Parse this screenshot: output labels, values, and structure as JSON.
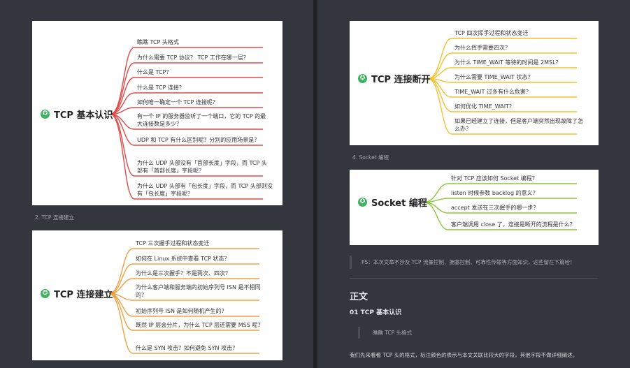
{
  "cards": {
    "basic": {
      "title": "TCP 基本认识",
      "color": "#e04a4a",
      "items": [
        "瞧瞧 TCP 头格式",
        "为什么需要 TCP 协议？ TCP 工作在哪一层？",
        "什么是 TCP？",
        "什么是 TCP 连接？",
        "如何唯一确定一个 TCP 连接呢？",
        "有一个 IP 的服务器监听了一个端口，它的 TCP 的最大连接数是多少？",
        "UDP 和 TCP 有什么区别呢？分别的应用场景是？",
        "为什么 UDP 头部没有「首部长度」字段，而 TCP 头部有「首部长度」字段呢？",
        "为什么 UDP 头部有「包长度」字段，而 TCP 头部则没有「包长度」字段呢？"
      ]
    },
    "establish": {
      "title": "TCP 连接建立",
      "color": "#f0a040",
      "items": [
        "TCP 三次握手过程和状态变迁",
        "如何在 Linux 系统中查看 TCP 状态？",
        "为什么是三次握手？不是两次、四次？",
        "为什么客户端和服务端的初始序列号 ISN 是不相同的？",
        "初始序列号 ISN 是如何随机产生的？",
        "既然 IP 层会分片，为什么 TCP 层还需要 MSS 呢？",
        "什么是 SYN 攻击？如何避免 SYN 攻击？"
      ]
    },
    "close": {
      "title": "TCP 连接断开",
      "color": "#f2c230",
      "items": [
        "TCP 四次挥手过程和状态变迁",
        "为什么挥手需要四次？",
        "为什么 TIME_WAIT 等待的时间是 2MSL？",
        "为什么需要 TIME_WAIT 状态？",
        "TIME_WAIT 过多有什么危害？",
        "如何优化 TIME_WAIT？",
        "如果已经建立了连接，但是客户端突然出现故障了怎么办？"
      ]
    },
    "socket": {
      "title": "Socket 编程",
      "color": "#8cc63e",
      "items": [
        "针对 TCP 应该如何 Socket 编程？",
        "listen 时候参数 backlog 的意义？",
        "accept 发送在三次握手的哪一步？",
        "客户端调用 close 了，连接是断开的流程是什么？"
      ]
    }
  },
  "captions": {
    "section2": "2. TCP 连接建立",
    "section4": "4. Socket 编程"
  },
  "ps_text": "PS：本次文章不涉及 TCP 流量控制、拥塞控制、可靠性传输等方面知识，这些留在下篇哈！",
  "body_heading": "正文",
  "sub_heading": "01 TCP 基本认识",
  "quote_small": "瞧瞧 TCP 头格式",
  "paragraph": "我们先来看看 TCP 头的格式，标注颜色的表示与本文关联比较大的字段，其他字段不做详细阐述。",
  "star_icon": "✪"
}
